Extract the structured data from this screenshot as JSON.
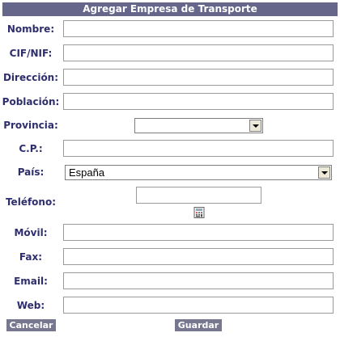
{
  "form": {
    "title": "Agregar Empresa de Transporte",
    "fields": {
      "nombre": {
        "label": "Nombre:",
        "value": ""
      },
      "cif": {
        "label": "CIF/NIF:",
        "value": ""
      },
      "direccion": {
        "label": "Dirección:",
        "value": ""
      },
      "poblacion": {
        "label": "Población:",
        "value": ""
      },
      "provincia": {
        "label": "Provincia:",
        "selected": ""
      },
      "cp": {
        "label": "C.P.:",
        "value": ""
      },
      "pais": {
        "label": "País:",
        "selected": "España"
      },
      "telefono": {
        "label": "Teléfono:",
        "value": "",
        "icon": "calculator-icon"
      },
      "movil": {
        "label": "Móvil:",
        "value": ""
      },
      "fax": {
        "label": "Fax:",
        "value": ""
      },
      "email": {
        "label": "Email:",
        "value": ""
      },
      "web": {
        "label": "Web:",
        "value": ""
      }
    },
    "buttons": {
      "cancel": "Cancelar",
      "save": "Guardar"
    }
  }
}
